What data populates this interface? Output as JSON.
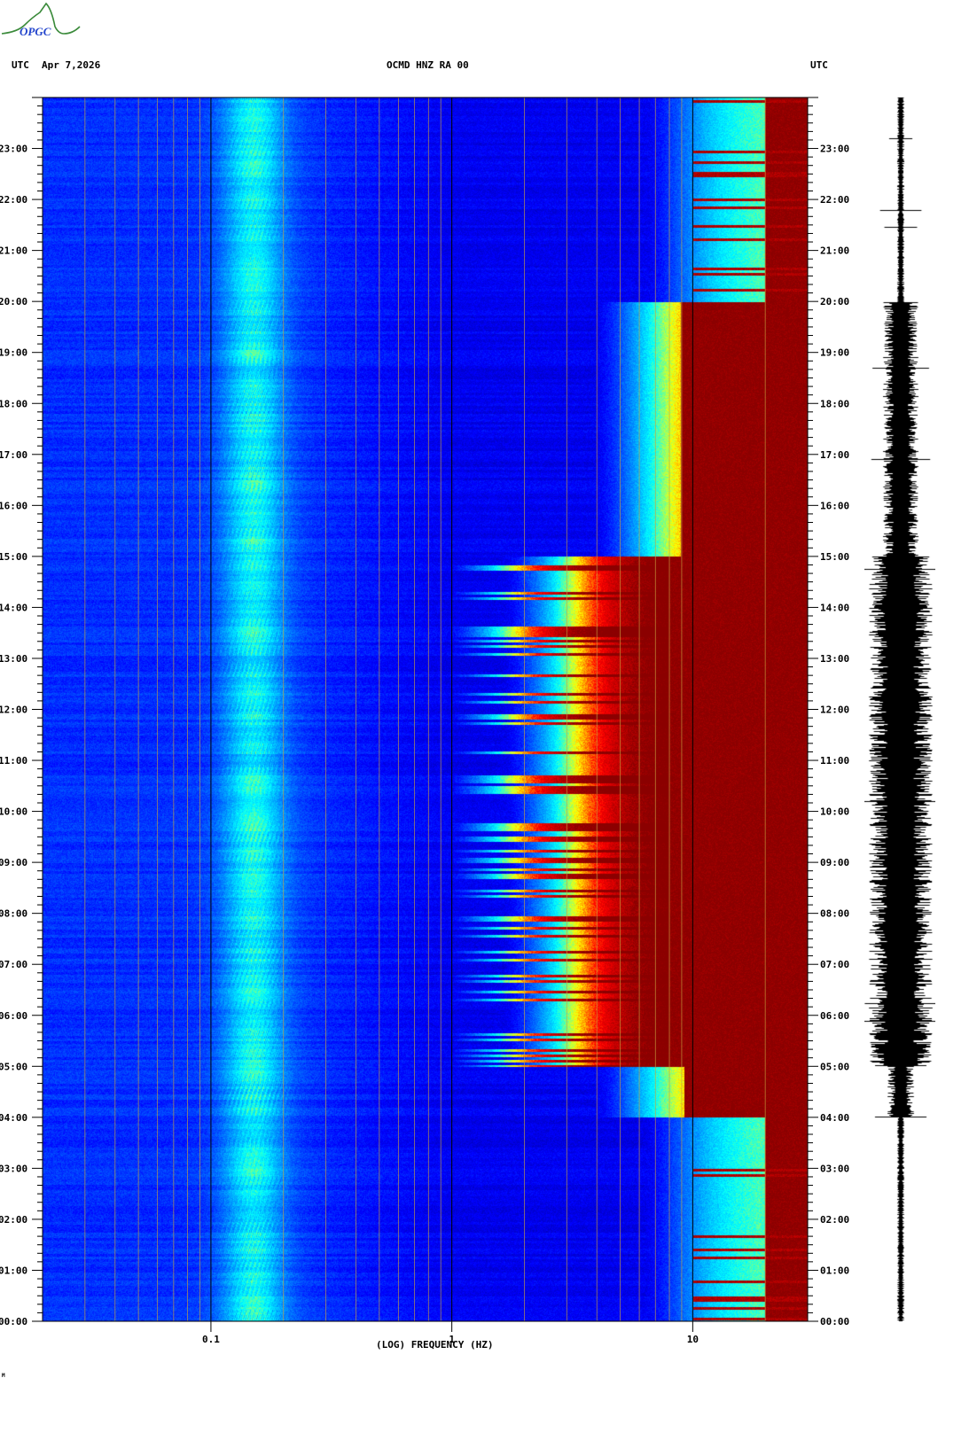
{
  "header": {
    "left_tz": "UTC",
    "date": "Apr 7,2026",
    "station": "OCMD HNZ RA 00",
    "right_tz": "UTC"
  },
  "logo": {
    "text": "OPGC",
    "color": "#3a8a3a",
    "text_color": "#2244cc"
  },
  "footer_mark": "M",
  "chart_data": {
    "type": "heatmap",
    "title": "OCMD HNZ RA 00",
    "xlabel": "(LOG) FREQUENCY (HZ)",
    "x_scale": "log",
    "xlim": [
      0.02,
      30
    ],
    "x_ticks": [
      {
        "value": 0.1,
        "label": "0.1"
      },
      {
        "value": 1,
        "label": "1"
      },
      {
        "value": 10,
        "label": "10"
      }
    ],
    "ylabel": "UTC",
    "ylim_hours": [
      0,
      24
    ],
    "y_ticks": [
      "00:00",
      "01:00",
      "02:00",
      "03:00",
      "04:00",
      "05:00",
      "06:00",
      "07:00",
      "08:00",
      "09:00",
      "10:00",
      "11:00",
      "12:00",
      "13:00",
      "14:00",
      "15:00",
      "16:00",
      "17:00",
      "18:00",
      "19:00",
      "20:00",
      "21:00",
      "22:00",
      "23:00"
    ],
    "colormap": [
      "#00008b",
      "#0000ff",
      "#0080ff",
      "#00ffff",
      "#ffff00",
      "#ff0000",
      "#8b0000"
    ],
    "features": {
      "microseism_peak_hz": 0.15,
      "high_activity_hours": [
        5,
        15
      ],
      "moderate_activity_hours": [
        15,
        20
      ],
      "night_hours": [
        [
          0,
          4
        ],
        [
          20,
          24
        ]
      ]
    },
    "seismogram": {
      "label": "HNZ trace"
    }
  }
}
